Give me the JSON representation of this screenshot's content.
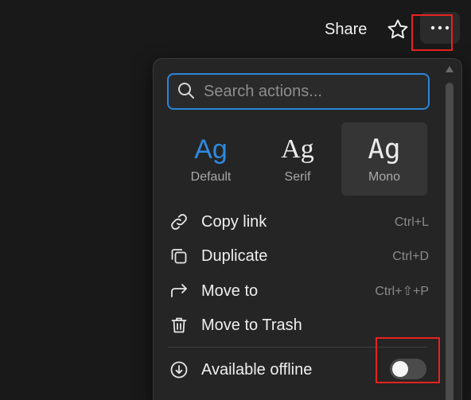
{
  "topbar": {
    "share_label": "Share",
    "star_icon": "star-icon",
    "more_icon": "more-horizontal-icon"
  },
  "menu": {
    "search": {
      "placeholder": "Search actions..."
    },
    "fonts": [
      {
        "glyph": "Ag",
        "label": "Default"
      },
      {
        "glyph": "Ag",
        "label": "Serif"
      },
      {
        "glyph": "Ag",
        "label": "Mono"
      }
    ],
    "items": [
      {
        "icon": "link-icon",
        "label": "Copy link",
        "shortcut": "Ctrl+L"
      },
      {
        "icon": "duplicate-icon",
        "label": "Duplicate",
        "shortcut": "Ctrl+D"
      },
      {
        "icon": "move-to-icon",
        "label": "Move to",
        "shortcut": "Ctrl+⇧+P"
      },
      {
        "icon": "trash-icon",
        "label": "Move to Trash",
        "shortcut": ""
      }
    ],
    "offline": {
      "icon": "download-circle-icon",
      "label": "Available offline",
      "enabled": false
    }
  },
  "colors": {
    "accent": "#2d85d8",
    "highlight": "#e6231f",
    "background": "#191919",
    "menu_background": "#252525"
  }
}
